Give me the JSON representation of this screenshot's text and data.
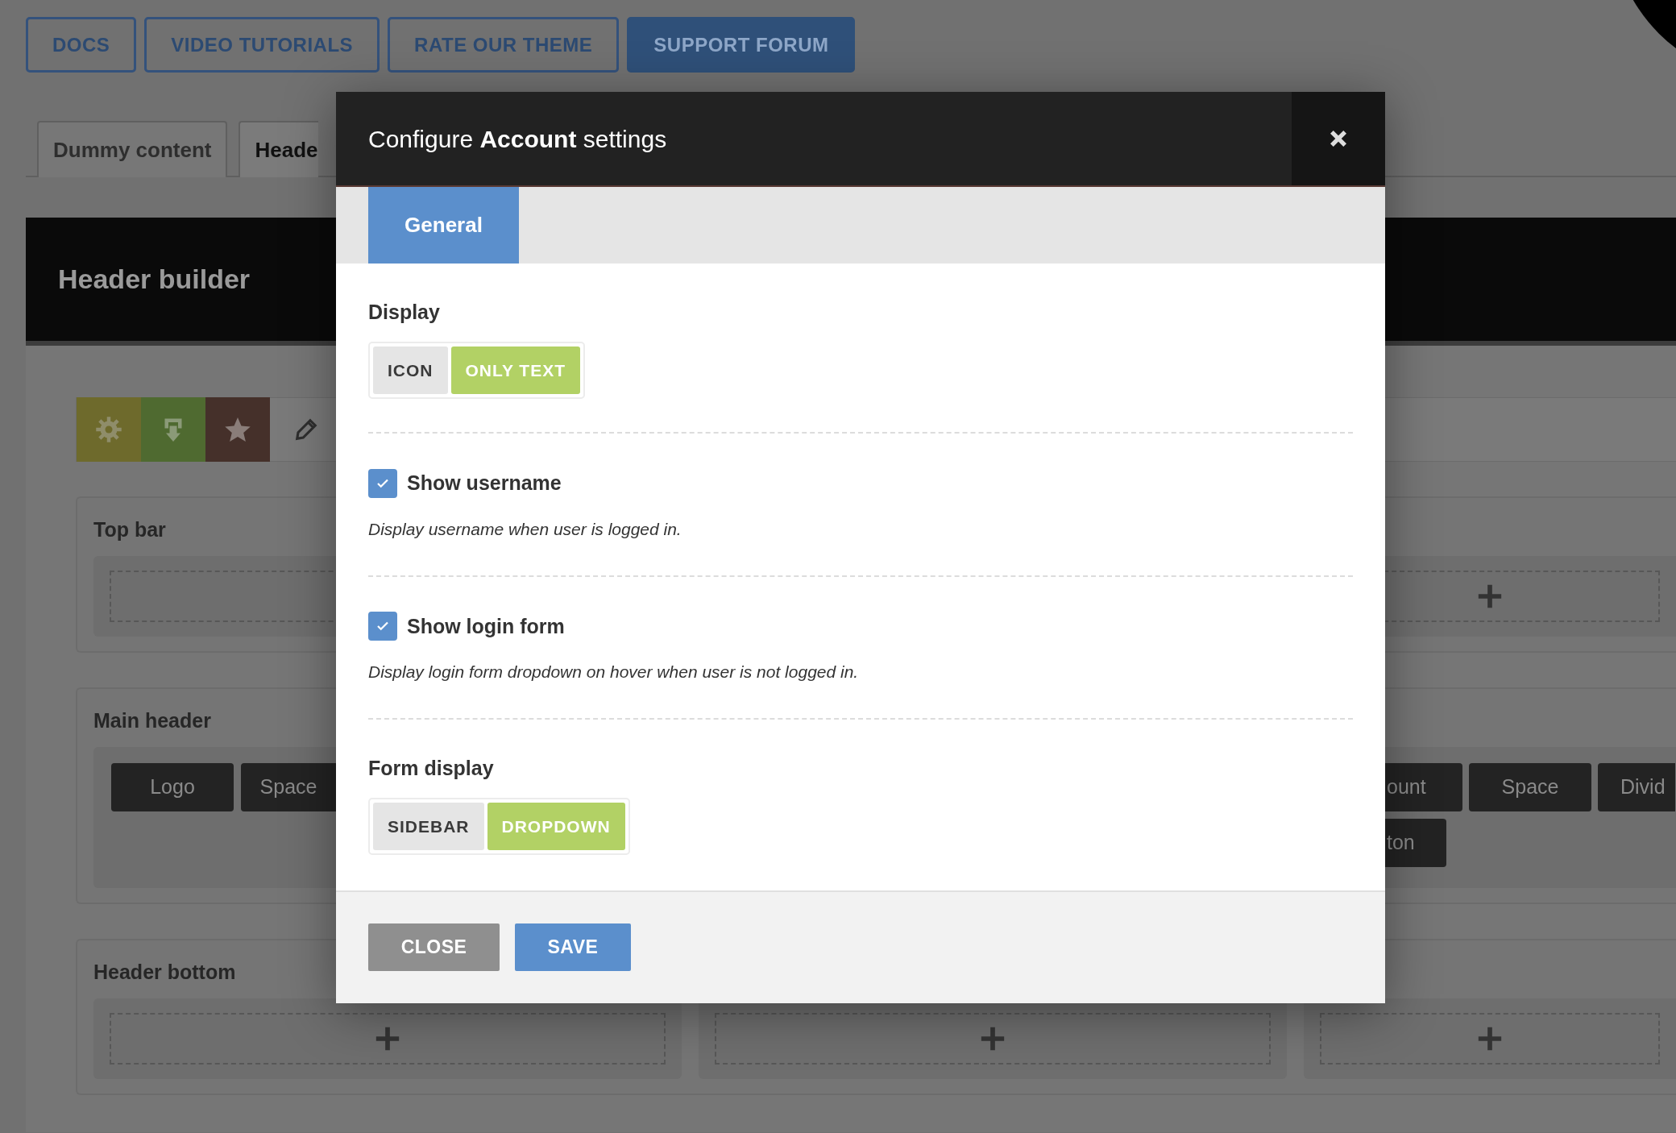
{
  "top_buttons": [
    {
      "label": "DOCS",
      "kind": "outline"
    },
    {
      "label": "VIDEO TUTORIALS",
      "kind": "outline"
    },
    {
      "label": "RATE OUR THEME",
      "kind": "outline"
    },
    {
      "label": "SUPPORT FORUM",
      "kind": "filled"
    }
  ],
  "tabs": [
    {
      "label": "Dummy content",
      "selected": false
    },
    {
      "label": "Heade",
      "selected": true
    }
  ],
  "builder": {
    "title": "Header builder",
    "tools": [
      {
        "kind": "gear",
        "color": "#6e6a2c"
      },
      {
        "kind": "download",
        "color": "#4f6a30"
      },
      {
        "kind": "star",
        "color": "#45302a"
      }
    ],
    "rows": [
      {
        "title": "Top bar",
        "kind": "zones"
      },
      {
        "title": "Main header",
        "kind": "items",
        "left_items": [
          "Logo",
          "Space"
        ],
        "right_items": [
          "ount",
          "Space",
          "Divid",
          "ton"
        ]
      },
      {
        "title": "Header bottom",
        "kind": "columns"
      }
    ]
  },
  "dialog": {
    "title": "Configure **Account** settings",
    "tabs": [
      {
        "label": "General",
        "selected": true
      }
    ],
    "settings": [
      {
        "kind": "toggle",
        "label": "Display",
        "options": [
          {
            "label": "ICON",
            "selected": false
          },
          {
            "label": "ONLY TEXT",
            "selected": true
          }
        ]
      },
      {
        "kind": "checkbox",
        "label": "Show username",
        "checked": true,
        "description": "Display username when user is logged in."
      },
      {
        "kind": "checkbox",
        "label": "Show login form",
        "checked": true,
        "description": "Display login form dropdown on hover when user is not logged in."
      },
      {
        "kind": "toggle",
        "label": "Form display",
        "options": [
          {
            "label": "SIDEBAR",
            "selected": false
          },
          {
            "label": "DROPDOWN",
            "selected": true
          }
        ]
      }
    ],
    "buttons": [
      {
        "label": "CLOSE",
        "kind": "secondary"
      },
      {
        "label": "SAVE",
        "kind": "primary"
      }
    ]
  }
}
